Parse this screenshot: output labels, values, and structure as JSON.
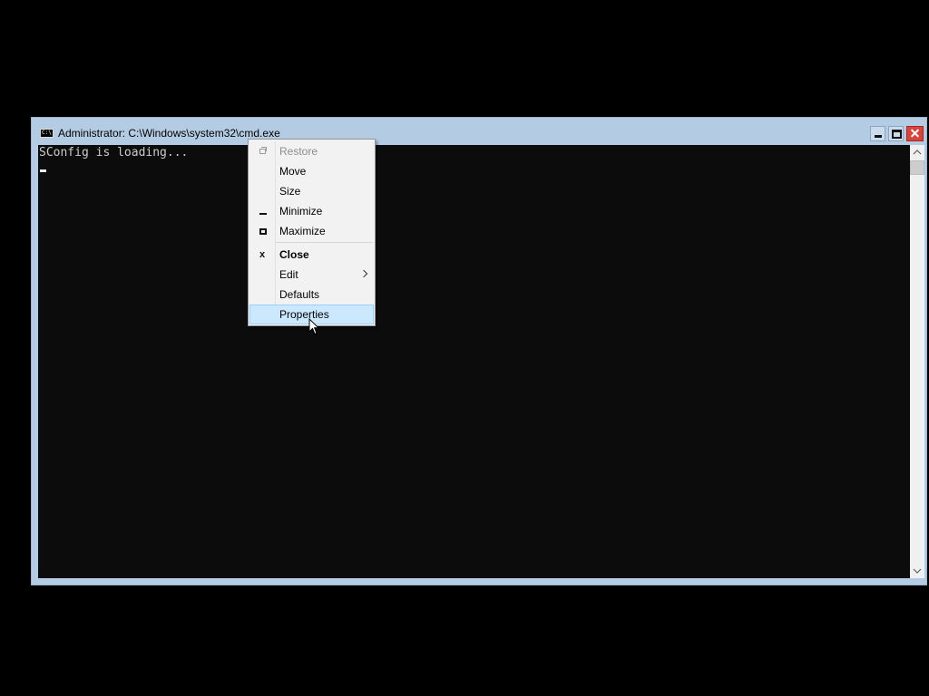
{
  "window": {
    "title": "Administrator: C:\\Windows\\system32\\cmd.exe",
    "icon": "cmd-icon",
    "icon_text": "C:\\",
    "controls": [
      "minimize-icon",
      "maximize-icon",
      "close-icon"
    ]
  },
  "console": {
    "lines": [
      "SConfig is loading..."
    ]
  },
  "system_menu": {
    "items": [
      {
        "label": "Restore",
        "icon": "restore-icon",
        "enabled": false
      },
      {
        "label": "Move",
        "icon": null,
        "enabled": true
      },
      {
        "label": "Size",
        "icon": null,
        "enabled": true
      },
      {
        "label": "Minimize",
        "icon": "minimize-icon",
        "enabled": true
      },
      {
        "label": "Maximize",
        "icon": "maximize-icon",
        "enabled": true
      },
      {
        "label": "Close",
        "icon": "close-icon",
        "enabled": true,
        "bold": true
      },
      {
        "label": "Edit",
        "icon": null,
        "enabled": true,
        "submenu": true
      },
      {
        "label": "Defaults",
        "icon": null,
        "enabled": true
      },
      {
        "label": "Properties",
        "icon": null,
        "enabled": true,
        "highlighted": true
      }
    ]
  },
  "colors": {
    "desktop": "#000000",
    "console_bg": "#0c0c0c",
    "console_text": "#cccccc",
    "frame": "#b4cce3",
    "close_button": "#d9443a",
    "menu_bg": "#f2f2f2",
    "menu_highlight": "#cce8ff"
  }
}
